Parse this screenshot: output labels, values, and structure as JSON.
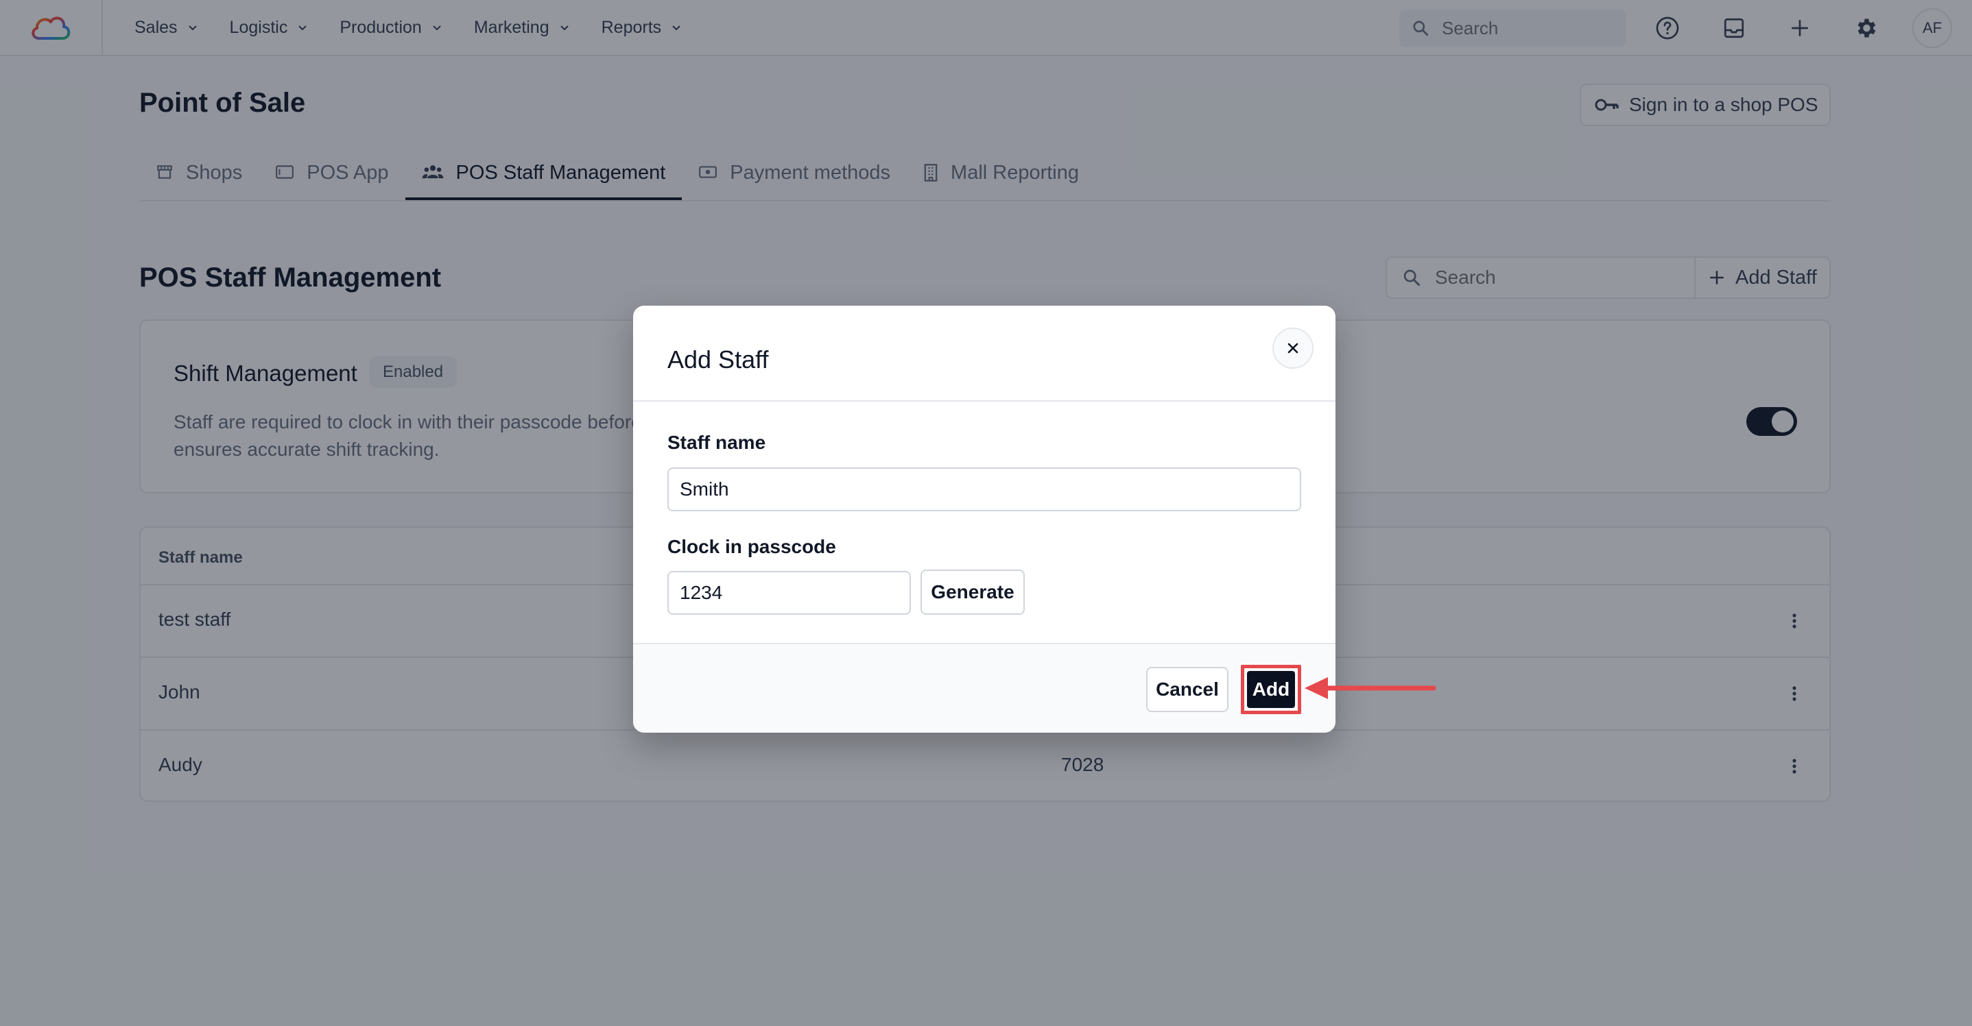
{
  "topbar": {
    "nav": [
      {
        "label": "Sales"
      },
      {
        "label": "Logistic"
      },
      {
        "label": "Production"
      },
      {
        "label": "Marketing"
      },
      {
        "label": "Reports"
      }
    ],
    "search_placeholder": "Search",
    "avatar_initials": "AF",
    "icons": [
      "cloud-logo-icon",
      "help-icon",
      "inbox-icon",
      "plus-icon",
      "gear-icon"
    ]
  },
  "header": {
    "title": "Point of Sale",
    "signin_label": "Sign in to a shop POS"
  },
  "tabs": [
    {
      "label": "Shops",
      "icon": "store-icon"
    },
    {
      "label": "POS App",
      "icon": "tablet-icon"
    },
    {
      "label": "POS Staff Management",
      "icon": "users-icon",
      "active": true
    },
    {
      "label": "Payment methods",
      "icon": "cash-icon"
    },
    {
      "label": "Mall Reporting",
      "icon": "building-icon"
    }
  ],
  "section": {
    "title": "POS Staff Management",
    "search_placeholder": "Search",
    "add_staff_label": "Add Staff"
  },
  "shift": {
    "title": "Shift Management",
    "badge": "Enabled",
    "desc_line1": "Staff are required to clock in with their passcode before",
    "desc_line2": "ensures accurate shift tracking.",
    "toggle_on": true
  },
  "table": {
    "col_name": "Staff name",
    "rows": [
      {
        "name": "test staff",
        "code": ""
      },
      {
        "name": "John",
        "code": ""
      },
      {
        "name": "Audy",
        "code": "7028"
      }
    ]
  },
  "modal": {
    "title": "Add Staff",
    "staff_name_label": "Staff name",
    "staff_name_value": "Smith",
    "passcode_label": "Clock in passcode",
    "passcode_value": "1234",
    "generate_label": "Generate",
    "cancel_label": "Cancel",
    "add_label": "Add"
  },
  "colors": {
    "highlight": "#e5484d",
    "primary": "#0b1020",
    "overlay": "rgba(17,24,39,0.45)"
  }
}
